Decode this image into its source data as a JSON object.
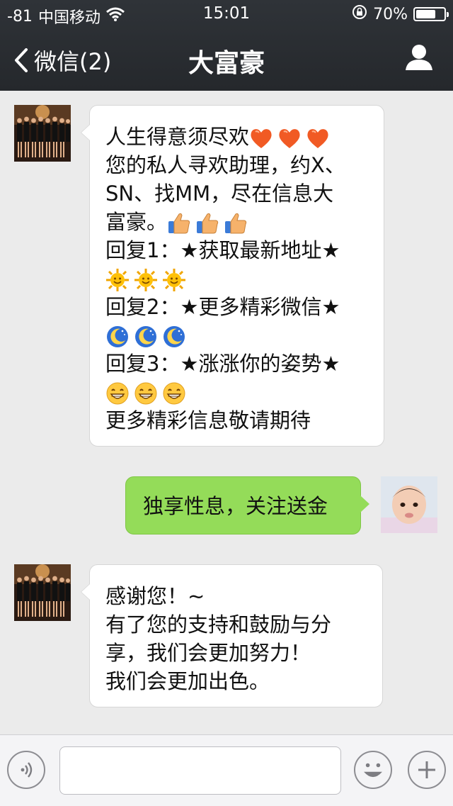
{
  "status_bar": {
    "signal": "-81",
    "carrier": "中国移动",
    "time": "15:01",
    "battery": "70%",
    "battery_level": 0.7
  },
  "nav": {
    "back_label": "微信(2)",
    "title": "大富豪"
  },
  "messages": [
    {
      "direction": "incoming",
      "avatar": "group-photo-avatar",
      "lines": [
        {
          "text": "人生得意须尽欢",
          "icons": [
            "heart-icon",
            "heart-icon",
            "heart-icon"
          ]
        },
        {
          "text": "您的私人寻欢助理，约X、"
        },
        {
          "text": "SN、找MM，尽在信息大"
        },
        {
          "text": "富豪。",
          "icons": [
            "thumbs-up-icon",
            "thumbs-up-icon",
            "thumbs-up-icon"
          ]
        },
        {
          "text": "回复1：★获取最新地址★"
        },
        {
          "text": "",
          "icons": [
            "sun-icon",
            "sun-icon",
            "sun-icon"
          ]
        },
        {
          "text": "回复2：★更多精彩微信★"
        },
        {
          "text": "",
          "icons": [
            "moon-icon",
            "moon-icon",
            "moon-icon"
          ]
        },
        {
          "text": "回复3：★涨涨你的姿势★"
        },
        {
          "text": "",
          "icons": [
            "grin-icon",
            "grin-icon",
            "grin-icon"
          ]
        },
        {
          "text": "更多精彩信息敬请期待"
        }
      ]
    },
    {
      "direction": "outgoing",
      "avatar": "baby-photo-avatar",
      "lines": [
        {
          "text": "独享性息，关注送金"
        }
      ]
    },
    {
      "direction": "incoming",
      "avatar": "group-photo-avatar",
      "lines": [
        {
          "text": "感谢您！~"
        },
        {
          "text": "有了您的支持和鼓励与分"
        },
        {
          "text": "享，我们会更加努力！"
        },
        {
          "text": "我们会更加出色。"
        }
      ]
    }
  ],
  "input_bar": {
    "input_value": "",
    "icons": [
      "voice-icon",
      "emoji-icon",
      "plus-icon"
    ]
  },
  "colors": {
    "header": "#2b2e33",
    "background": "#ebebeb",
    "outgoing_bubble": "#94dc59",
    "incoming_bubble": "#ffffff"
  }
}
